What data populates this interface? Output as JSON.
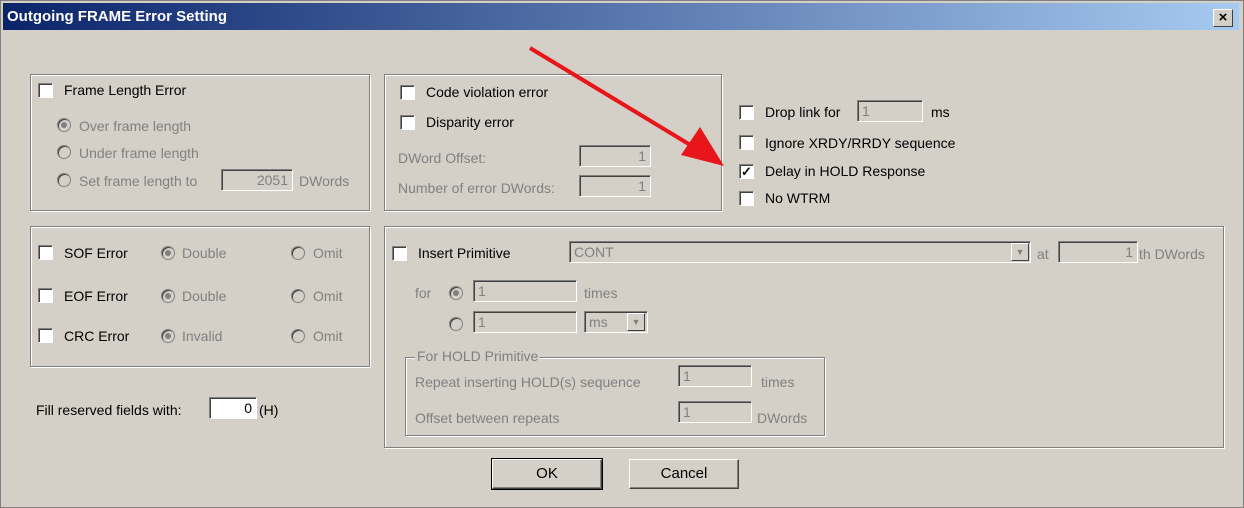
{
  "window": {
    "title": "Outgoing FRAME Error Setting",
    "close_glyph": "×"
  },
  "frame_length": {
    "checkbox_label": "Frame Length Error",
    "checked": false,
    "over_label": "Over frame length",
    "under_label": "Under frame length",
    "set_label": "Set frame length to",
    "set_value": "2051",
    "set_unit": "DWords"
  },
  "code_group": {
    "code_violation_label": "Code violation error",
    "disparity_label": "Disparity error",
    "dword_offset_label": "DWord Offset:",
    "dword_offset_value": "1",
    "num_error_label": "Number of error DWords:",
    "num_error_value": "1"
  },
  "right_options": {
    "drop_link_label": "Drop link for",
    "drop_link_value": "1",
    "drop_link_unit": "ms",
    "ignore_label": "Ignore XRDY/RRDY sequence",
    "delay_label": "Delay  in HOLD Response",
    "delay_checked": true,
    "no_wtrm_label": "No WTRM"
  },
  "errors": {
    "sof_label": "SOF Error",
    "eof_label": "EOF Error",
    "crc_label": "CRC Error",
    "double_label": "Double",
    "invalid_label": "Invalid",
    "omit_label": "Omit"
  },
  "fill": {
    "label": "Fill reserved fields with:",
    "value": "0",
    "unit": "(H)"
  },
  "primitive": {
    "checkbox_label": "Insert Primitive",
    "selected": "CONT",
    "at_label": "at",
    "at_value": "1",
    "at_unit": "th  DWords",
    "for_label": "for",
    "times_value": "1",
    "times_label": "times",
    "time_value": "1",
    "time_unit": "ms",
    "hold_group_label": "For HOLD Primitive",
    "repeat_label": "Repeat inserting HOLD(s) sequence",
    "repeat_value": "1",
    "repeat_unit": "times",
    "offset_label": "Offset between repeats",
    "offset_value": "1",
    "offset_unit": "DWords"
  },
  "buttons": {
    "ok": "OK",
    "cancel": "Cancel"
  },
  "annotation": {
    "arrow_color": "#e8151b"
  }
}
